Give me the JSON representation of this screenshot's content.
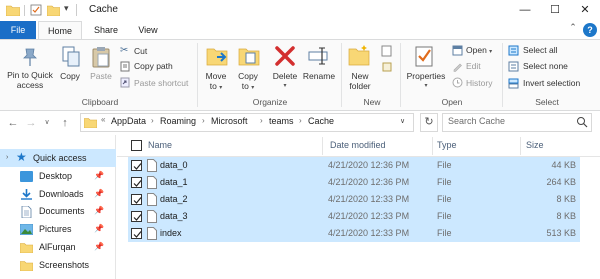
{
  "window": {
    "title": "Cache",
    "controls": {
      "minimize": "—",
      "maximize": "☐",
      "close": "✕"
    }
  },
  "ribbon_tabs": [
    {
      "label": "File"
    },
    {
      "label": "Home"
    },
    {
      "label": "Share"
    },
    {
      "label": "View"
    }
  ],
  "ribbon": {
    "clipboard": {
      "pin_label_1": "Pin to Quick",
      "pin_label_2": "access",
      "copy": "Copy",
      "paste": "Paste",
      "cut": "Cut",
      "copy_path": "Copy path",
      "paste_shortcut": "Paste shortcut",
      "group": "Clipboard"
    },
    "organize": {
      "move_to_1": "Move",
      "move_to_2": "to",
      "copy_to_1": "Copy",
      "copy_to_2": "to",
      "delete": "Delete",
      "rename": "Rename",
      "group": "Organize"
    },
    "new": {
      "new_folder_1": "New",
      "new_folder_2": "folder",
      "group": "New"
    },
    "open": {
      "properties": "Properties",
      "open": "Open",
      "edit": "Edit",
      "history": "History",
      "group": "Open"
    },
    "select": {
      "select_all": "Select all",
      "select_none": "Select none",
      "invert_selection": "Invert selection",
      "group": "Select"
    }
  },
  "address": {
    "prefix": "«",
    "crumbs": [
      "AppData",
      "Roaming",
      "Microsoft",
      "teams",
      "Cache"
    ],
    "search_placeholder": "Search Cache"
  },
  "nav_pane": {
    "items": [
      {
        "label": "Quick access",
        "icon": "star-icon",
        "pinned": false
      },
      {
        "label": "Desktop",
        "icon": "desktop-folder-icon",
        "pinned": true
      },
      {
        "label": "Downloads",
        "icon": "downloads-folder-icon",
        "pinned": true
      },
      {
        "label": "Documents",
        "icon": "documents-folder-icon",
        "pinned": true
      },
      {
        "label": "Pictures",
        "icon": "pictures-folder-icon",
        "pinned": true
      },
      {
        "label": "AlFurqan",
        "icon": "folder-icon",
        "pinned": true
      },
      {
        "label": "Screenshots",
        "icon": "folder-icon",
        "pinned": false
      }
    ]
  },
  "columns": {
    "name": "Name",
    "date": "Date modified",
    "type": "Type",
    "size": "Size"
  },
  "files": [
    {
      "name": "data_0",
      "date": "4/21/2020 12:36 PM",
      "type": "File",
      "size": "44 KB"
    },
    {
      "name": "data_1",
      "date": "4/21/2020 12:36 PM",
      "type": "File",
      "size": "264 KB"
    },
    {
      "name": "data_2",
      "date": "4/21/2020 12:33 PM",
      "type": "File",
      "size": "8 KB"
    },
    {
      "name": "data_3",
      "date": "4/21/2020 12:33 PM",
      "type": "File",
      "size": "8 KB"
    },
    {
      "name": "index",
      "date": "4/21/2020 12:33 PM",
      "type": "File",
      "size": "513 KB"
    }
  ],
  "colors": {
    "accent": "#1a6ec7",
    "selection": "#cce8ff",
    "folder": "#f8d775",
    "delete_red": "#d32f2f"
  }
}
